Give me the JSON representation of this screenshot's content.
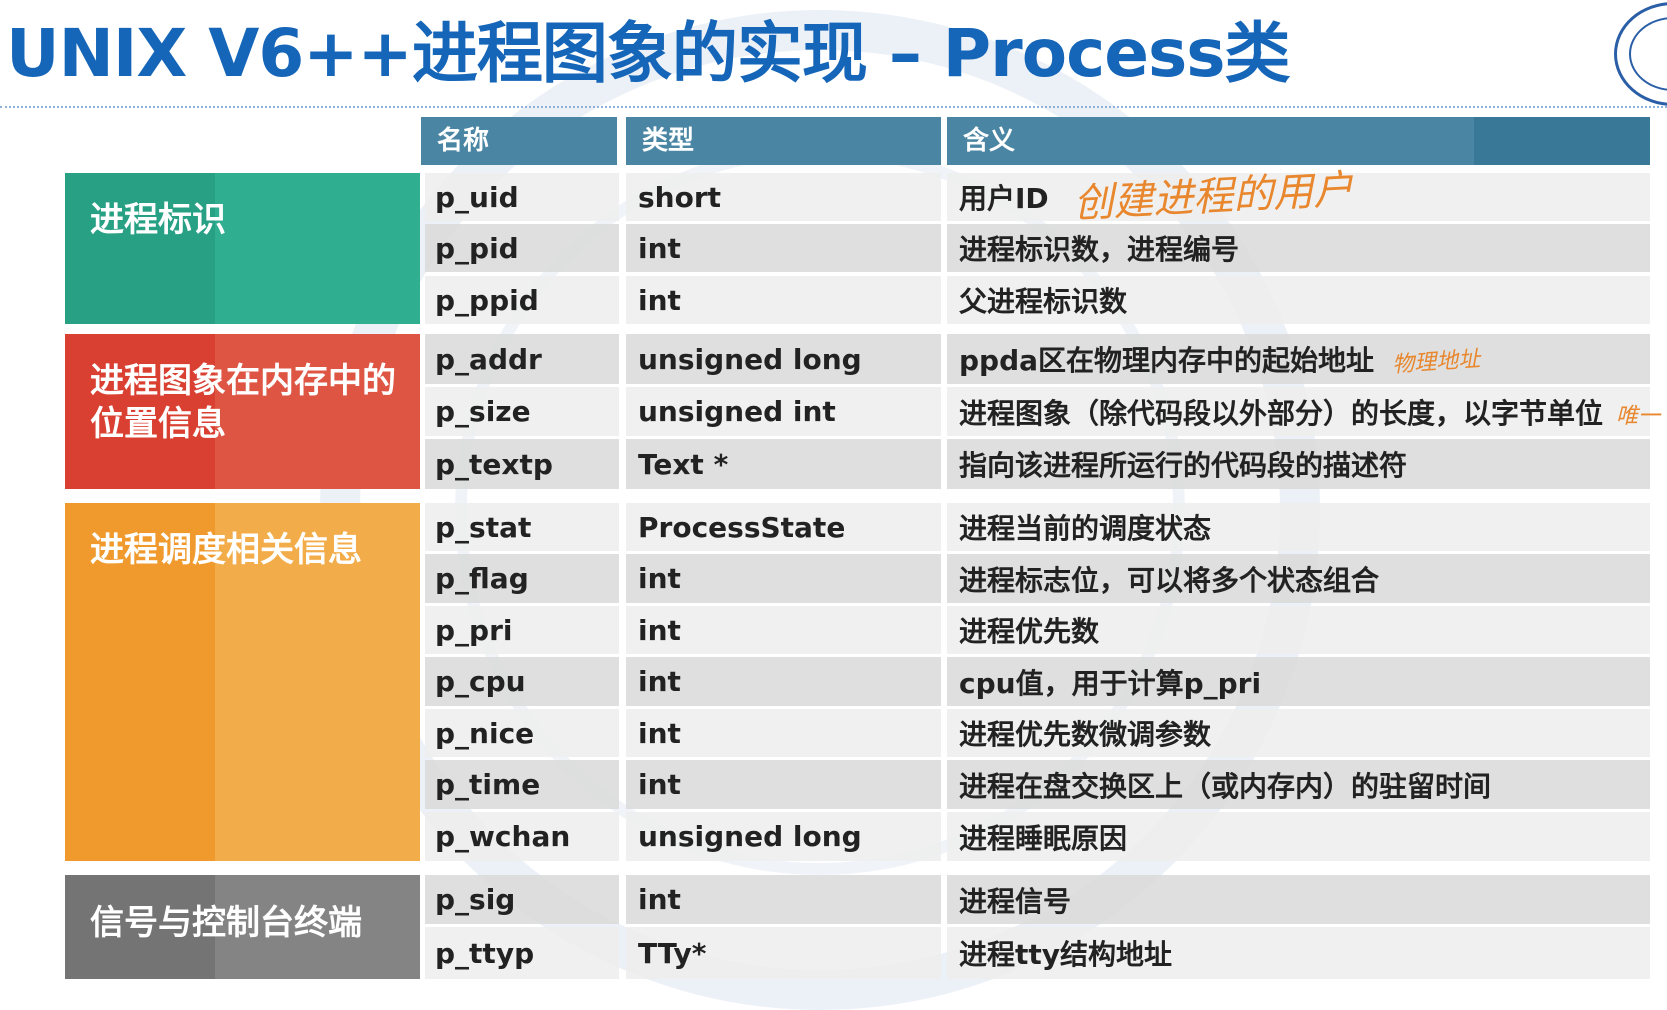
{
  "slide": {
    "title": "UNIX V6++进程图象的实现 – Process类"
  },
  "table": {
    "headers": [
      "名称",
      "类型",
      "含义"
    ],
    "groups": [
      {
        "label": "进程标识"
      },
      {
        "label": "进程图象在内存中的位置信息"
      },
      {
        "label": "进程调度相关信息"
      },
      {
        "label": "信号与控制台终端"
      }
    ],
    "rows": [
      {
        "name": "p_uid",
        "type": "short",
        "meaning": "用户ID"
      },
      {
        "name": "p_pid",
        "type": "int",
        "meaning": "进程标识数，进程编号"
      },
      {
        "name": "p_ppid",
        "type": "int",
        "meaning": "父进程标识数"
      },
      {
        "name": "p_addr",
        "type": "unsigned long",
        "meaning": "ppda区在物理内存中的起始地址"
      },
      {
        "name": "p_size",
        "type": "unsigned int",
        "meaning": "进程图象（除代码段以外部分）的长度，以字节单位"
      },
      {
        "name": "p_textp",
        "type": "Text *",
        "meaning": "指向该进程所运行的代码段的描述符"
      },
      {
        "name": "p_stat",
        "type": "ProcessState",
        "meaning": "进程当前的调度状态"
      },
      {
        "name": "p_flag",
        "type": "int",
        "meaning": "进程标志位，可以将多个状态组合"
      },
      {
        "name": "p_pri",
        "type": "int",
        "meaning": "进程优先数"
      },
      {
        "name": "p_cpu",
        "type": "int",
        "meaning": "cpu值，用于计算p_pri"
      },
      {
        "name": "p_nice",
        "type": "int",
        "meaning": "进程优先数微调参数"
      },
      {
        "name": "p_time",
        "type": "int",
        "meaning": "进程在盘交换区上（或内存内）的驻留时间"
      },
      {
        "name": "p_wchan",
        "type": "unsigned long",
        "meaning": "进程睡眠原因"
      },
      {
        "name": "p_sig",
        "type": "int",
        "meaning": "进程信号"
      },
      {
        "name": "p_ttyp",
        "type": "TTy*",
        "meaning": "进程tty结构地址"
      }
    ]
  },
  "annotations": {
    "note_uid": "创建进程的用户",
    "note_addr": "物理地址",
    "note_size": "唯一"
  }
}
